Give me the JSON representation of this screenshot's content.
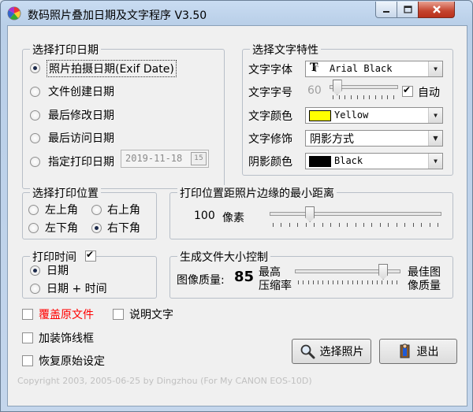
{
  "window": {
    "title": "数码照片叠加日期及文字程序 V3.50",
    "buttons": {
      "minimize": "minimize",
      "maximize": "maximize",
      "close": "close"
    }
  },
  "print_date": {
    "label": "选择打印日期",
    "options": [
      "照片拍摄日期(Exif Date)",
      "文件创建日期",
      "最后修改日期",
      "最后访问日期",
      "指定打印日期"
    ],
    "selected_index": 0,
    "date_value": "2019-11-18",
    "date_button": "15"
  },
  "text_props": {
    "label": "选择文字特性",
    "font_label": "文字字体",
    "font_value": "Arial Black",
    "font_icon": "truetype-icon",
    "size_label": "文字字号",
    "size_value": "60",
    "size_fraction": 0.06,
    "auto_label": "自动",
    "auto_checked": true,
    "color_label": "文字颜色",
    "color_value": "Yellow",
    "color_hex": "#ffff00",
    "style_label": "文字修饰",
    "style_value": "阴影方式",
    "shadow_label": "阴影颜色",
    "shadow_value": "Black",
    "shadow_hex": "#000000"
  },
  "position": {
    "label": "选择打印位置",
    "options": [
      "左上角",
      "右上角",
      "左下角",
      "右下角"
    ],
    "selected_index": 3
  },
  "margin": {
    "label": "打印位置距照片边缘的最小距离",
    "value": "100",
    "unit": "像素",
    "fraction": 0.22
  },
  "print_time": {
    "label": "打印时间",
    "checked": true,
    "options": [
      "日期",
      "日期 + 时间"
    ],
    "selected_index": 0
  },
  "file_size": {
    "label": "生成文件大小控制",
    "quality_label": "图像质量:",
    "quality_value": "85",
    "left_label_1": "最高",
    "left_label_2": "压缩率",
    "right_label_1": "最佳图",
    "right_label_2": "像质量",
    "fraction": 0.85
  },
  "options": {
    "overwrite": "覆盖原文件",
    "overwrite_color": "#ff0000",
    "caption": "说明文字",
    "frame": "加装饰线框",
    "reset": "恢复原始设定"
  },
  "actions": {
    "select_photo": "选择照片",
    "exit": "退出"
  },
  "footer": "Copyright 2003, 2005-06-25 by Dingzhou     (For My CANON EOS-10D)"
}
